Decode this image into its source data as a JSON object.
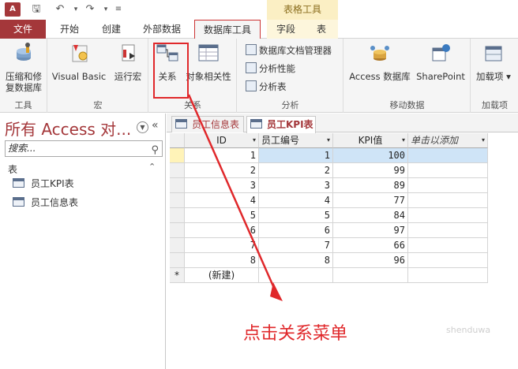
{
  "title_bar": {
    "app_icon_label": "A",
    "context_header": "表格工具"
  },
  "tabs": [
    {
      "label": "文件"
    },
    {
      "label": "开始"
    },
    {
      "label": "创建"
    },
    {
      "label": "外部数据"
    },
    {
      "label": "数据库工具"
    },
    {
      "label": "字段"
    },
    {
      "label": "表"
    }
  ],
  "ribbon": {
    "tools": {
      "compact_line1": "压缩和修",
      "compact_line2": "复数据库",
      "group_label": "工具"
    },
    "macro": {
      "visual_basic": "Visual Basic",
      "run_macro": "运行宏",
      "group_label": "宏"
    },
    "relationships": {
      "relations": "关系",
      "object_dependencies": "对象相关性",
      "group_label": "关系"
    },
    "analyze": {
      "documenter": "数据库文档管理器",
      "performance": "分析性能",
      "analyze_table": "分析表",
      "group_label": "分析"
    },
    "move_data": {
      "access_db": "Access 数据库",
      "sharepoint": "SharePoint",
      "group_label": "移动数据"
    },
    "addins": {
      "addins": "加载项",
      "group_label": "加载项"
    }
  },
  "nav_pane": {
    "title": "所有 Access 对...",
    "search_placeholder": "搜索...",
    "section": "表",
    "items": [
      {
        "label": "员工KPI表"
      },
      {
        "label": "员工信息表"
      }
    ]
  },
  "doc_tabs": [
    {
      "label": "员工信息表"
    },
    {
      "label": "员工KPI表"
    }
  ],
  "datasheet": {
    "columns": [
      "ID",
      "员工编号",
      "KPI值",
      "单击以添加"
    ],
    "rows": [
      {
        "id": "1",
        "emp": "1",
        "kpi": "100"
      },
      {
        "id": "2",
        "emp": "2",
        "kpi": "99"
      },
      {
        "id": "3",
        "emp": "3",
        "kpi": "89"
      },
      {
        "id": "4",
        "emp": "4",
        "kpi": "77"
      },
      {
        "id": "5",
        "emp": "5",
        "kpi": "84"
      },
      {
        "id": "6",
        "emp": "6",
        "kpi": "97"
      },
      {
        "id": "7",
        "emp": "7",
        "kpi": "66"
      },
      {
        "id": "8",
        "emp": "8",
        "kpi": "96"
      }
    ],
    "new_row_marker": "*",
    "new_row_label": "(新建)"
  },
  "annotation": {
    "text": "点击关系菜单",
    "color": "#e0282b"
  },
  "watermark": "shenduwa"
}
